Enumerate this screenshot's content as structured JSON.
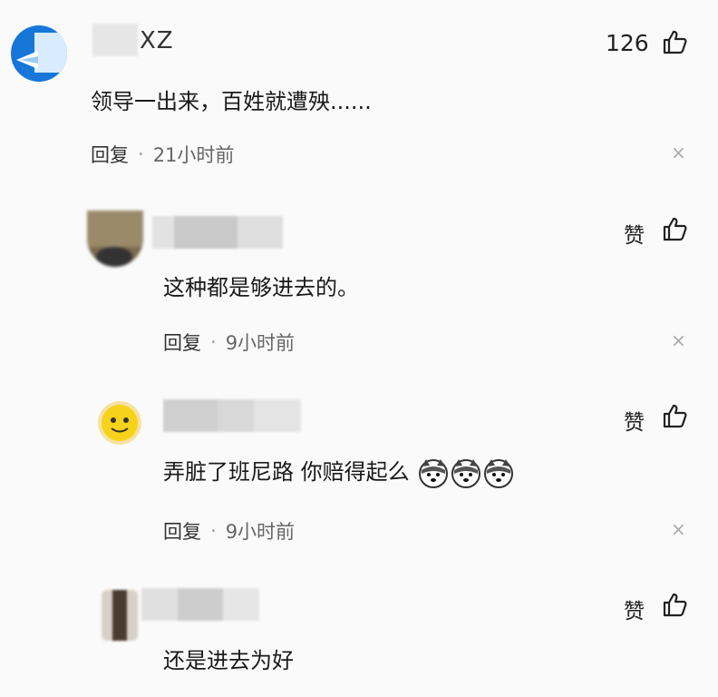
{
  "comments": [
    {
      "username_visible": "XZ",
      "text": "领导一出来，百姓就遭殃......",
      "like": "126",
      "reply": "回复",
      "dot": "·",
      "time": "21小时前",
      "close": "×",
      "avatar": "blue-logo-avatar"
    },
    {
      "text": "这种都是够进去的。",
      "like": "赞",
      "reply": "回复",
      "dot": "·",
      "time": "9小时前",
      "close": "×",
      "avatar": "dark-avatar"
    },
    {
      "text": "弄脏了班尼路 你赔得起么",
      "like": "赞",
      "reply": "回复",
      "dot": "·",
      "time": "9小时前",
      "close": "×",
      "avatar": "yellow-emoji-avatar",
      "emojis": [
        "husky-emoji",
        "husky-emoji",
        "husky-emoji"
      ]
    },
    {
      "text": "还是进去为好",
      "like": "赞",
      "avatar": "dark-portrait-avatar"
    }
  ],
  "colors": {
    "accent_blue": "#1677d8",
    "text": "#1a1a1a",
    "meta": "#666666"
  }
}
